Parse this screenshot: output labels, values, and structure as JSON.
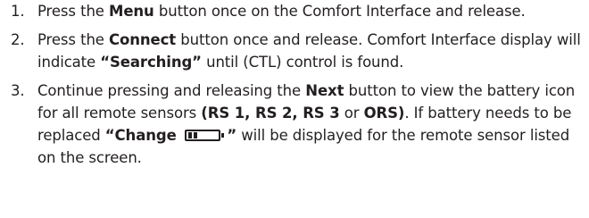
{
  "steps": [
    {
      "number": "1.",
      "t1": "Press the ",
      "b1": "Menu",
      "t2": " button once on the Comfort Interface and release."
    },
    {
      "number": "2.",
      "t1": "Press the ",
      "b1": "Connect",
      "t2": " button once and release. Comfort Interface display will indicate ",
      "b2": "“Searching”",
      "t3": " until (CTL) control is found."
    },
    {
      "number": "3.",
      "t1": "Continue pressing and releasing the ",
      "b1": "Next",
      "t2": " button to view the battery icon for all remote sensors ",
      "b2": "(RS 1, RS 2, RS 3",
      "t3": " or ",
      "b3": "ORS)",
      "t4": ". If battery needs to be replaced ",
      "b4": "“Change ",
      "icon": "battery-icon",
      "b5": "”",
      "t5": " will be displayed for the remote sensor listed on the screen."
    }
  ]
}
